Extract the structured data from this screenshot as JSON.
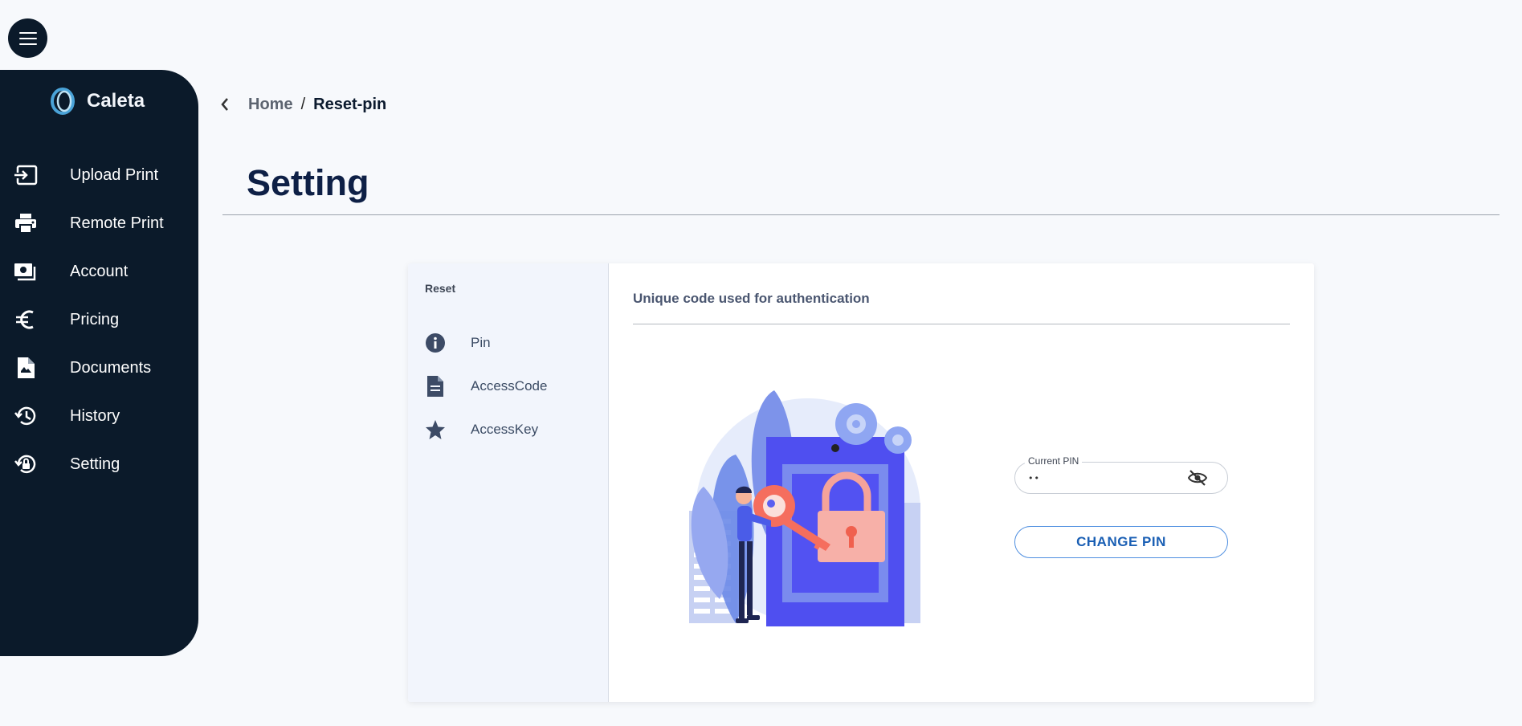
{
  "app": {
    "brand_name": "Caleta"
  },
  "sidebar": {
    "items": [
      {
        "label": "Upload Print",
        "icon": "upload-icon"
      },
      {
        "label": "Remote Print",
        "icon": "printer-icon"
      },
      {
        "label": "Account",
        "icon": "wallet-icon"
      },
      {
        "label": "Pricing",
        "icon": "euro-icon"
      },
      {
        "label": "Documents",
        "icon": "document-icon"
      },
      {
        "label": "History",
        "icon": "history-icon"
      },
      {
        "label": "Setting",
        "icon": "setting-lock-icon"
      }
    ]
  },
  "breadcrumb": {
    "home": "Home",
    "separator": "/",
    "current": "Reset-pin"
  },
  "page": {
    "title": "Setting"
  },
  "reset_panel": {
    "heading": "Reset",
    "items": [
      {
        "label": "Pin",
        "icon": "info-icon"
      },
      {
        "label": "AccessCode",
        "icon": "document-lines-icon"
      },
      {
        "label": "AccessKey",
        "icon": "star-icon"
      }
    ]
  },
  "pin_section": {
    "heading": "Unique code used for authentication",
    "field_label": "Current PIN",
    "field_value": "••",
    "button_label": "CHANGE PIN"
  },
  "colors": {
    "sidebar_bg": "#0b1a2a",
    "page_bg": "#f7f9fc",
    "accent": "#1a5fb4",
    "illustration_primary": "#5b5ff0",
    "illustration_accent": "#f5796b"
  }
}
